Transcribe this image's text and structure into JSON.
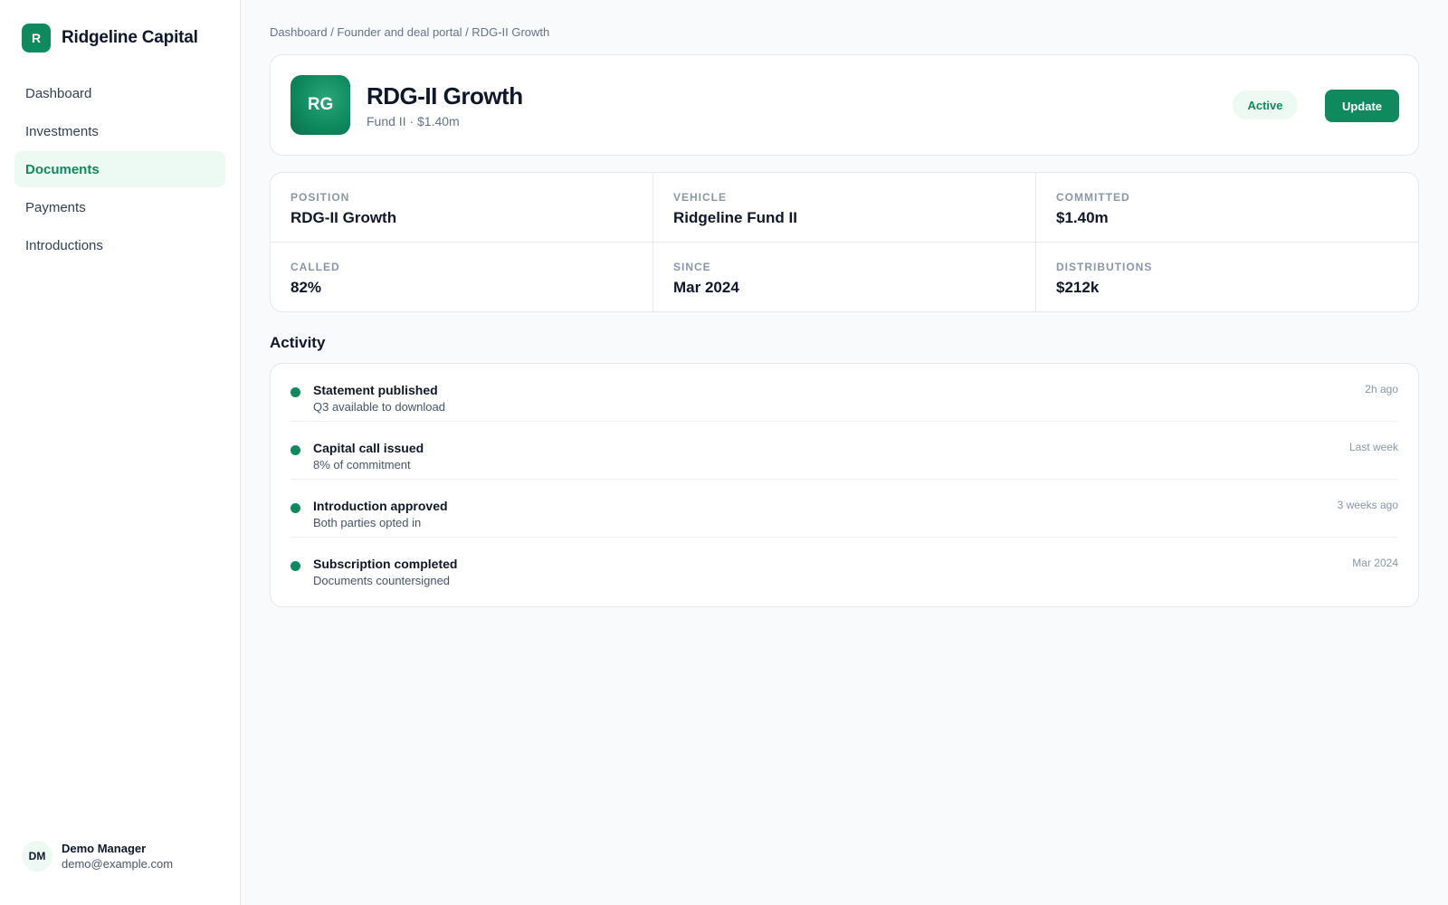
{
  "brand": {
    "mark": "R",
    "name": "Ridgeline Capital"
  },
  "nav": [
    {
      "label": "Dashboard"
    },
    {
      "label": "Investments"
    },
    {
      "label": "Documents"
    },
    {
      "label": "Payments"
    },
    {
      "label": "Introductions"
    }
  ],
  "user": {
    "initials": "DM",
    "name": "Demo Manager",
    "email": "demo@example.com"
  },
  "breadcrumb": "Dashboard / Founder and deal portal / RDG-II Growth",
  "fund": {
    "logo_initials": "RG",
    "title": "RDG-II Growth",
    "subtitle": "Fund II · $1.40m",
    "status": "Active",
    "update_label": "Update"
  },
  "stats": [
    {
      "label": "Position",
      "value": "RDG-II Growth"
    },
    {
      "label": "Vehicle",
      "value": "Ridgeline Fund II"
    },
    {
      "label": "Committed",
      "value": "$1.40m"
    },
    {
      "label": "Called",
      "value": "82%"
    },
    {
      "label": "Since",
      "value": "Mar 2024"
    },
    {
      "label": "Distributions",
      "value": "$212k"
    }
  ],
  "activity": {
    "title": "Activity",
    "items": [
      {
        "title": "Statement published",
        "subtitle": "Q3 available to download",
        "time": "2h ago"
      },
      {
        "title": "Capital call issued",
        "subtitle": "8% of commitment",
        "time": "Last week"
      },
      {
        "title": "Introduction approved",
        "subtitle": "Both parties opted in",
        "time": "3 weeks ago"
      },
      {
        "title": "Subscription completed",
        "subtitle": "Documents countersigned",
        "time": "Mar 2024"
      }
    ]
  },
  "colors": {
    "accent": "#0f8a5f",
    "accent_soft": "#ecfaf3"
  }
}
